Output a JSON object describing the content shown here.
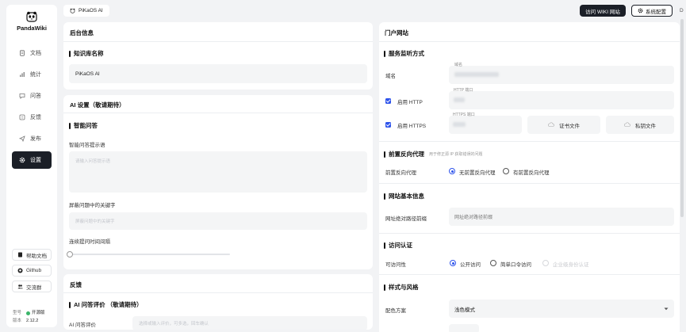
{
  "app": {
    "name": "PandaWiki",
    "version_label": "版本",
    "version": "2.12.2",
    "edition_label": "型号",
    "edition": "开源版"
  },
  "nav": [
    {
      "label": "文档",
      "icon": "document-icon"
    },
    {
      "label": "统计",
      "icon": "chart-icon"
    },
    {
      "label": "问答",
      "icon": "chat-icon"
    },
    {
      "label": "反馈",
      "icon": "feedback-icon"
    },
    {
      "label": "发布",
      "icon": "send-icon"
    },
    {
      "label": "设置",
      "icon": "gear-icon",
      "active": true
    }
  ],
  "bottom_links": [
    {
      "label": "帮助文档",
      "icon": "book-icon"
    },
    {
      "label": "Github",
      "icon": "github-icon"
    },
    {
      "label": "交流群",
      "icon": "group-icon"
    }
  ],
  "topbar": {
    "kb_name": "PiKaOS AI",
    "visit_wiki": "访问 WIKI 网站",
    "system_config": "系统配置",
    "cut_text": "D"
  },
  "backend": {
    "title": "后台信息",
    "kb_name_section": "知识库名称",
    "kb_name_value": "PiKaOS AI"
  },
  "ai": {
    "title": "AI 设置（敬请期待）",
    "smart_qa_section": "智能问答",
    "prompt_label": "智能问答提示语",
    "prompt_placeholder": "请输入问答提示语",
    "block_label": "屏蔽问题中的关键字",
    "block_placeholder": "屏蔽问题中的关键字",
    "interval_label": "连续提问时间间隔",
    "slider_value": 0
  },
  "feedback": {
    "title": "反馈",
    "ai_eval_section": "AI 问答评价 （敬请期待）",
    "ai_eval_label": "AI 问答评价",
    "ai_eval_placeholder": "选择或输入评价，可多选，回车确认"
  },
  "portal": {
    "title": "门户网站",
    "listen_section": "服务监听方式",
    "domain_label": "域名",
    "domain_hint": "域名",
    "http_label": "启用 HTTP",
    "http_hint": "HTTP 端口",
    "https_label": "启用 HTTPS",
    "https_hint": "HTTPS 端口",
    "cert_button": "证书文件",
    "key_button": "私钥文件",
    "proxy_section": "前置反向代理",
    "proxy_hint": "用于修正源 IP 获取错误的问题",
    "proxy_label": "前置反向代理",
    "proxy_options": [
      "无前置反向代理",
      "有前置反向代理"
    ],
    "site_section": "网站基本信息",
    "base_path_label": "网址绝对路径前缀",
    "base_path_placeholder": "网址绝对路径前缀",
    "auth_section": "访问认证",
    "visibility_label": "可访问性",
    "visibility_options": [
      "公开访问",
      "简单口令访问",
      "企业级身份认证"
    ],
    "style_section": "样式与风格",
    "theme_label": "配色方案",
    "theme_value": "浅色模式"
  }
}
